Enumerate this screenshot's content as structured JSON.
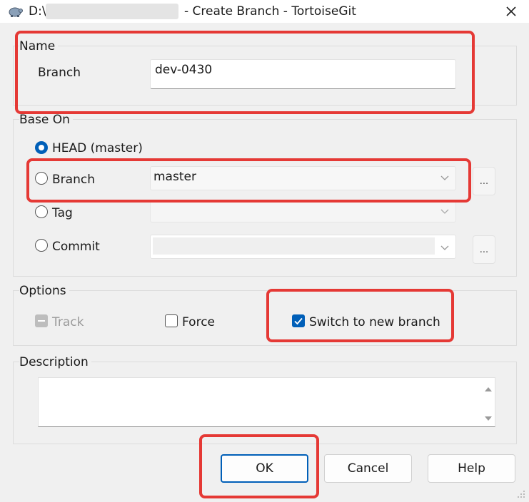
{
  "window": {
    "title_path": "D:\\",
    "title": "- Create Branch - TortoiseGit",
    "close_icon": "close-icon",
    "app_icon": "tortoisegit-icon"
  },
  "name_group": {
    "label": "Name",
    "branch_label": "Branch",
    "branch_value": "dev-0430"
  },
  "base_on": {
    "label": "Base On",
    "head_label": "HEAD (master)",
    "branch_label": "Branch",
    "branch_value": "master",
    "tag_label": "Tag",
    "tag_value": "",
    "commit_label": "Commit",
    "commit_value": "",
    "browse_label": "..."
  },
  "options": {
    "label": "Options",
    "track_label": "Track",
    "force_label": "Force",
    "switch_label": "Switch to new branch"
  },
  "description": {
    "label": "Description",
    "value": ""
  },
  "buttons": {
    "ok": "OK",
    "cancel": "Cancel",
    "help": "Help"
  },
  "colors": {
    "accent": "#005fb8",
    "highlight": "#e53935"
  }
}
